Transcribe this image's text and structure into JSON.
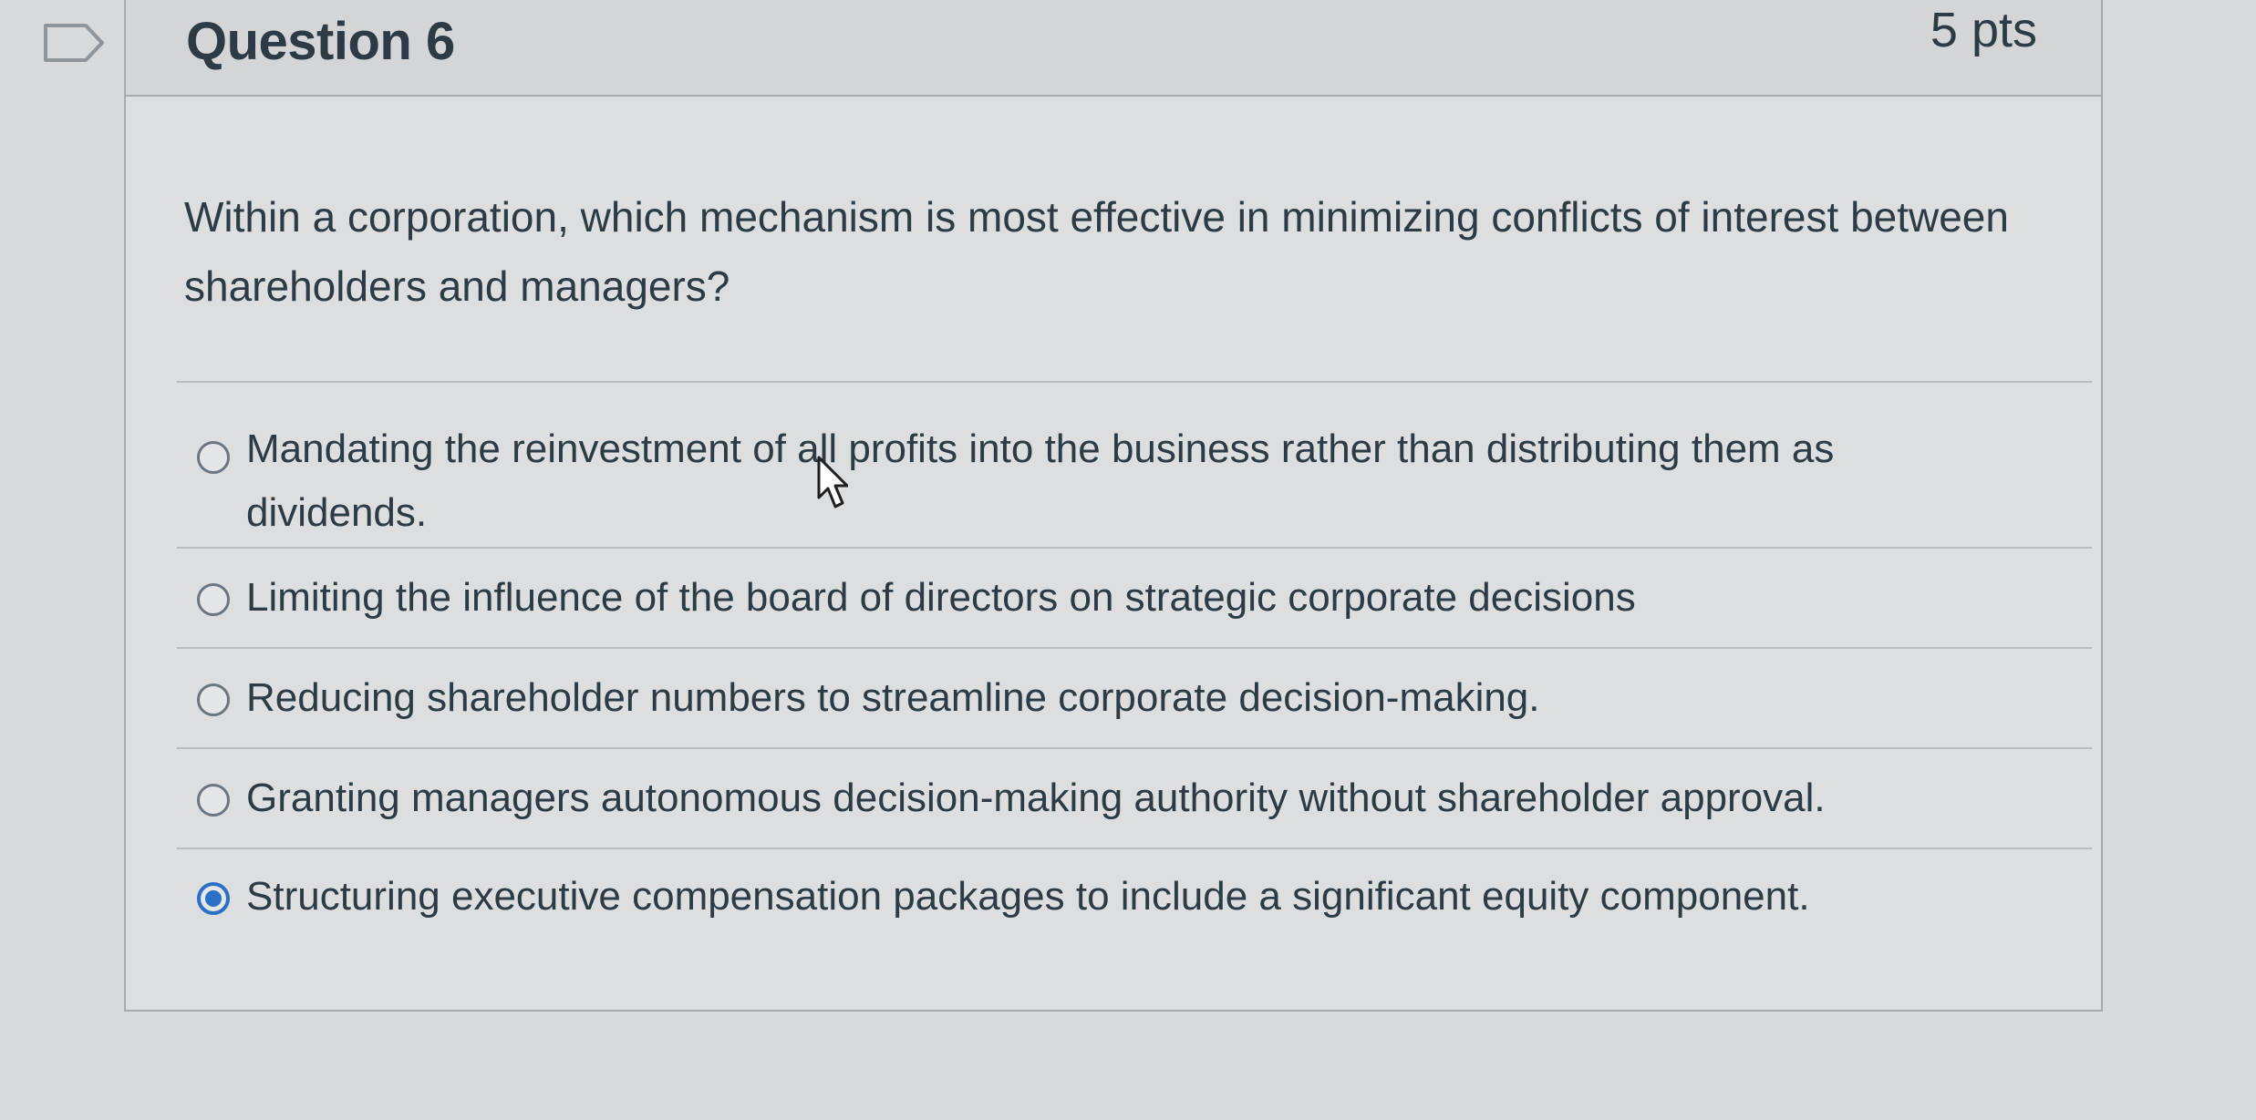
{
  "question": {
    "title": "Question 6",
    "points": "5 pts",
    "text": "Within a corporation, which mechanism is most effective in minimizing conflicts of interest between shareholders and managers?",
    "answers": [
      {
        "label": "Mandating the reinvestment of all profits into the business rather than distributing them as dividends.",
        "selected": false
      },
      {
        "label": "Limiting the influence of the board of directors on strategic corporate decisions",
        "selected": false
      },
      {
        "label": "Reducing shareholder numbers to streamline corporate decision-making.",
        "selected": false
      },
      {
        "label": "Granting managers autonomous decision-making authority without shareholder approval.",
        "selected": false
      },
      {
        "label": "Structuring executive compensation packages to include a significant equity component.",
        "selected": true
      }
    ]
  },
  "icons": {
    "flag": "flag-question-icon",
    "radio": "radio-button-icon",
    "cursor": "mouse-pointer-icon"
  },
  "colors": {
    "accent": "#2b6fc6",
    "text": "#2d3b45",
    "background": "#d8dadb"
  }
}
